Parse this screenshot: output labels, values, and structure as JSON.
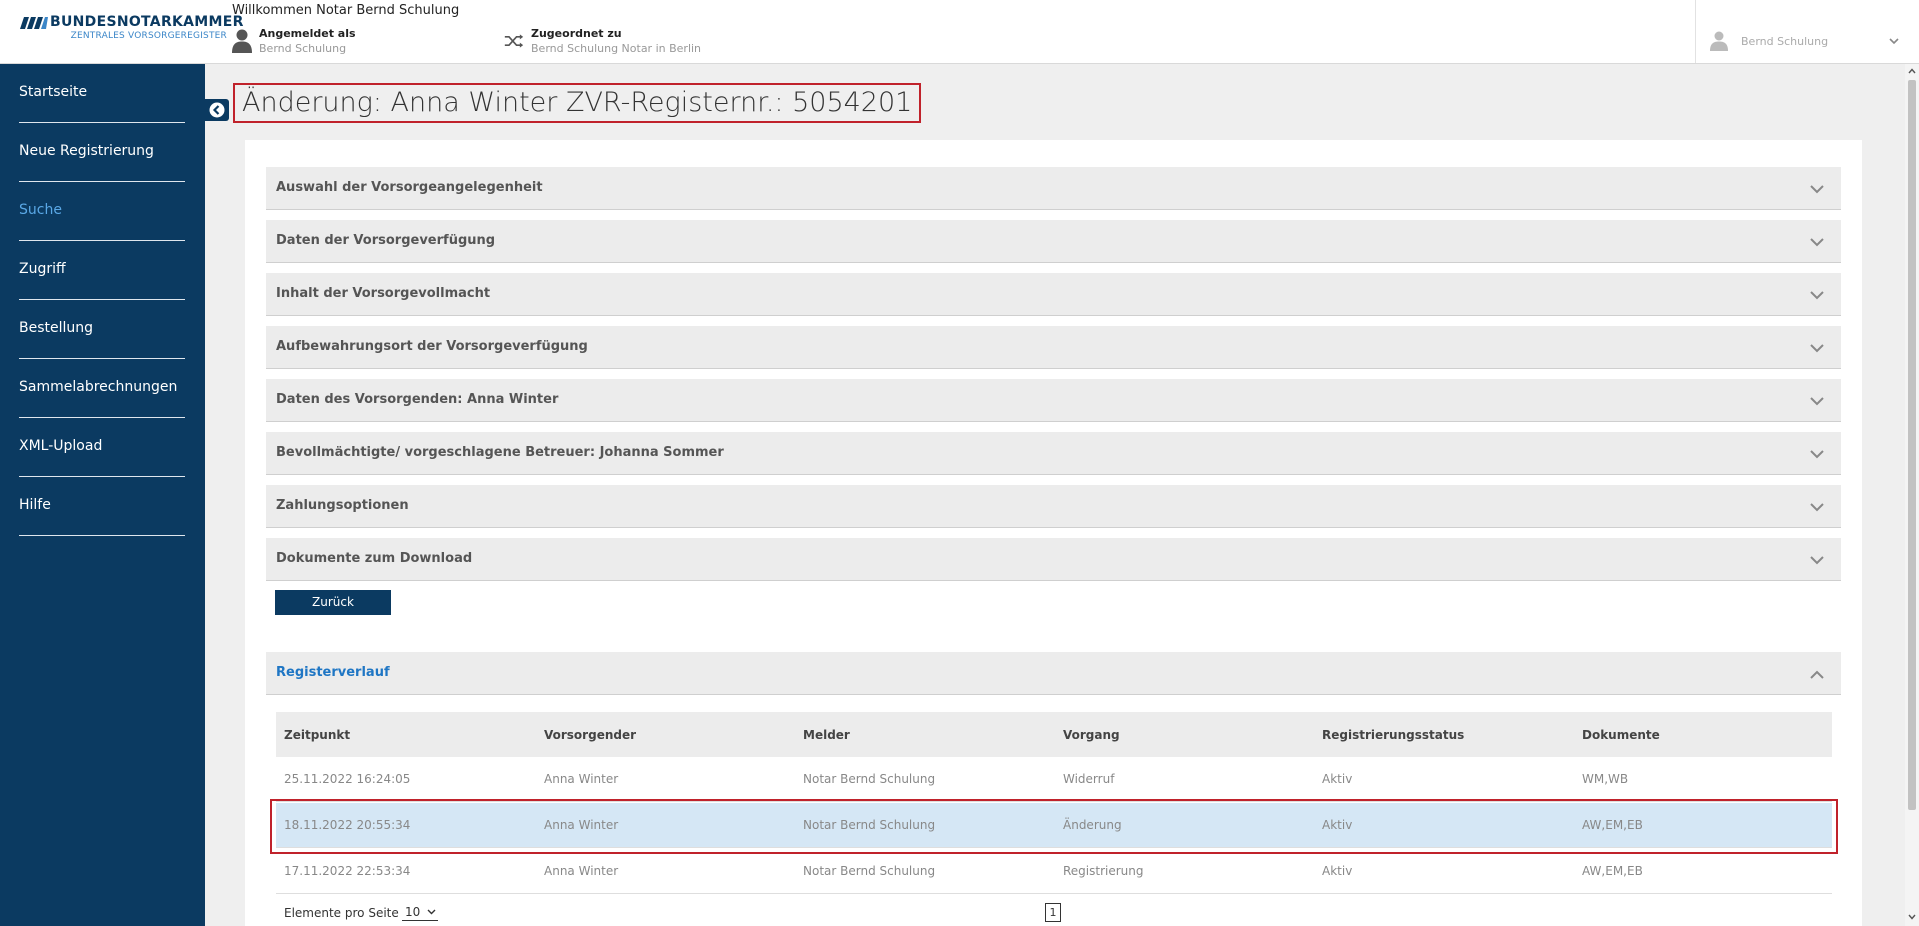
{
  "header": {
    "logo_title": "BUNDESNOTARKAMMER",
    "logo_subtitle": "ZENTRALES VORSORGEREGISTER",
    "welcome": "Willkommen Notar Bernd Schulung",
    "logged_in_label": "Angemeldet als",
    "logged_in_value": "Bernd Schulung",
    "assigned_label": "Zugeordnet zu",
    "assigned_value": "Bernd Schulung Notar in Berlin",
    "user_name": "Bernd Schulung"
  },
  "sidebar": {
    "items": [
      {
        "label": "Startseite"
      },
      {
        "label": "Neue Registrierung"
      },
      {
        "label": "Suche",
        "active": true
      },
      {
        "label": "Zugriff"
      },
      {
        "label": "Bestellung"
      },
      {
        "label": "Sammelabrechnungen"
      },
      {
        "label": "XML-Upload"
      },
      {
        "label": "Hilfe"
      }
    ]
  },
  "page": {
    "title": "Änderung: Anna Winter ZVR-Registernr.: 5054201"
  },
  "sections": [
    "Auswahl der Vorsorgeangelegenheit",
    "Daten der Vorsorgeverfügung",
    "Inhalt der Vorsorgevollmacht",
    "Aufbewahrungsort der Vorsorgeverfügung",
    "Daten des Vorsorgenden: Anna Winter",
    "Bevollmächtigte/ vorgeschlagene Betreuer: Johanna Sommer",
    "Zahlungsoptionen",
    "Dokumente zum Download"
  ],
  "back_button": "Zurück",
  "history": {
    "title": "Registerverlauf",
    "columns": [
      "Zeitpunkt",
      "Vorsorgender",
      "Melder",
      "Vorgang",
      "Registrierungsstatus",
      "Dokumente"
    ],
    "rows": [
      [
        "25.11.2022 16:24:05",
        "Anna Winter",
        "Notar Bernd Schulung",
        "Widerruf",
        "Aktiv",
        "WM,WB"
      ],
      [
        "18.11.2022 20:55:34",
        "Anna Winter",
        "Notar Bernd Schulung",
        "Änderung",
        "Aktiv",
        "AW,EM,EB"
      ],
      [
        "17.11.2022 22:53:34",
        "Anna Winter",
        "Notar Bernd Schulung",
        "Registrierung",
        "Aktiv",
        "AW,EM,EB"
      ]
    ],
    "highlighted_row": 1,
    "per_page_label": "Elemente pro Seite",
    "per_page_value": "10",
    "current_page": "1"
  },
  "colors": {
    "sidebar_bg": "#0b3a61",
    "accent_blue": "#1f76c4",
    "highlight_red": "#c0222b",
    "row_highlight": "#d5e7f5"
  },
  "icons": {
    "user": "person-icon",
    "assigned": "shuffle-icon",
    "chevron": "chevron-down-icon",
    "collapse": "chevron-left-circle-icon"
  }
}
